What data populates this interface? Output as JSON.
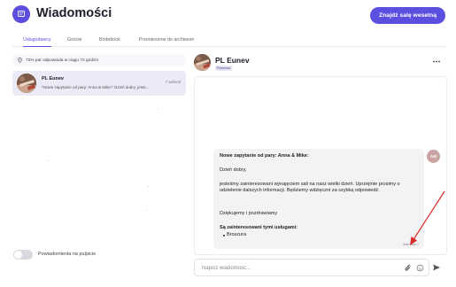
{
  "header": {
    "title": "Wiadomości",
    "logo_icon": "chat-icon",
    "cta_label": "Znajdź salę weselną"
  },
  "tabs": [
    {
      "label": "Usługodawcy",
      "active": true
    },
    {
      "label": "Goście",
      "active": false
    },
    {
      "label": "Bridebook",
      "active": false
    },
    {
      "label": "Przeniesione do archiwum",
      "active": false
    }
  ],
  "sidebar": {
    "response_rate": "72% par odpowiada w ciągu 72 godzin",
    "conversations": [
      {
        "name": "PL Eunev",
        "time": "7 sekund",
        "preview": "*Nowe zapytanie od pary: Anna & Mike:* Dzień dobry, jeste..."
      }
    ],
    "notifications_label": "Powiadomienia na pulpicie",
    "notifications_enabled": false
  },
  "chat": {
    "name": "PL Eunev",
    "badge": "Rezerwa",
    "more_icon": "more-options-icon",
    "message": {
      "heading": "Nowe zapytanie od pary: Anna & Mike:",
      "greeting": "Dzień dobry,",
      "body_line1": "jesteśmy zainteresowani wynajęciem sali na nasz wielki dzień. Uprzejmie prosimy o",
      "body_line2": "udzielenie dalszych informacji. Będziemy wdzięczni za szybką odpowiedź.",
      "closing": "Dziękujemy i pozdrawiamy",
      "services_heading": "Są zainteresowani tymi usługami:",
      "services": [
        "Broszura"
      ],
      "timestamp": "Just now ✓",
      "sender_initials": "AM"
    },
    "composer": {
      "placeholder": "Napisz wiadomość..."
    }
  },
  "colors": {
    "accent": "#5b4fe0",
    "selected_row": "#ebeaf7",
    "bubble": "#f3f3f6",
    "annotation_arrow": "#d62a2a"
  }
}
